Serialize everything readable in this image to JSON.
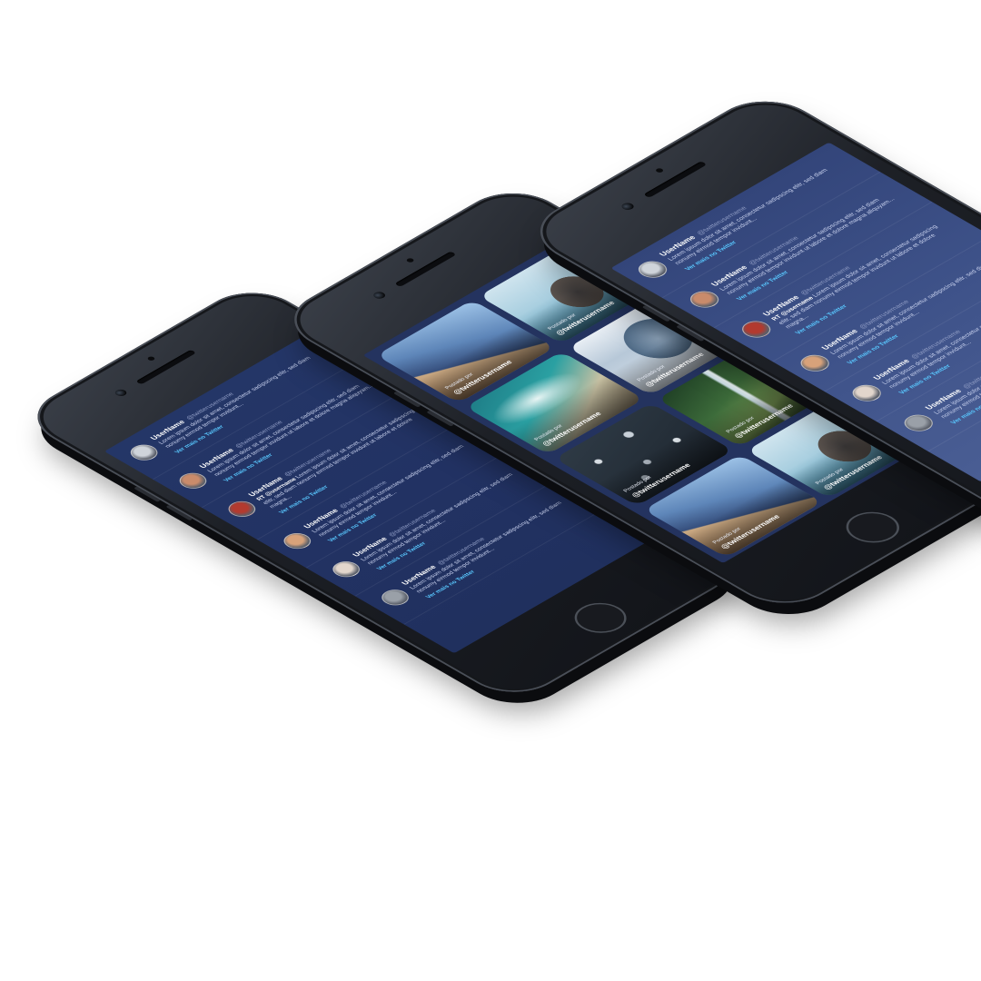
{
  "colors": {
    "screen_bg": "#223263",
    "link": "#59c8ff",
    "phone_body": "#1d2026",
    "background": "#ffffff"
  },
  "feed": {
    "see_more": "Ver mais no Twitter",
    "tweets": [
      {
        "username": "UserName",
        "handle": "@twitterusername",
        "text": "Lorem ipsum dolor sit amet, consectetur sadipscing elitr, sed diam nonumy eirmod tempor invidunt...",
        "mention": ""
      },
      {
        "username": "UserName",
        "handle": "@twitterusername",
        "text": "Lorem ipsum dolor sit amet, consectetur sadipscing elitr, sed diam nonumy eirmod tempor invidunt ut labore et dolore magna aliquyam...",
        "mention": ""
      },
      {
        "username": "UserName",
        "handle": "@twitterusername",
        "text": "Lorem ipsum dolor sit amet, consectetur sadipscing elitr, sed diam nonumy eirmod tempor invidunt ut labore et dolore magna...",
        "mention": "RT @username"
      },
      {
        "username": "UserName",
        "handle": "@twitterusername",
        "text": "Lorem ipsum dolor sit amet, consectetur sadipscing elitr, sed diam nonumy eirmod tempor invidunt...",
        "mention": ""
      },
      {
        "username": "UserName",
        "handle": "@twitterusername",
        "text": "Lorem ipsum dolor sit amet, consectetur sadipscing elitr, sed diam nonumy eirmod tempor invidunt...",
        "mention": ""
      },
      {
        "username": "UserName",
        "handle": "@twitterusername",
        "text": "Lorem ipsum dolor sit amet, consectetur sadipscing elitr, sed diam nonumy eirmod tempor invidunt...",
        "mention": ""
      }
    ]
  },
  "gallery": {
    "posted_by": "Postado por",
    "cards": [
      {
        "image": "sky",
        "username": "@twitterusername"
      },
      {
        "image": "rock",
        "username": "@twitterusername"
      },
      {
        "image": "sea",
        "username": "@twitterusername"
      },
      {
        "image": "mountain",
        "username": "@twitterusername"
      },
      {
        "image": "dots",
        "username": "@twitterusername"
      },
      {
        "image": "forest",
        "username": "@twitterusername"
      },
      {
        "image": "sky",
        "username": "@twitterusername"
      },
      {
        "image": "rock",
        "username": "@twitterusername"
      }
    ]
  }
}
